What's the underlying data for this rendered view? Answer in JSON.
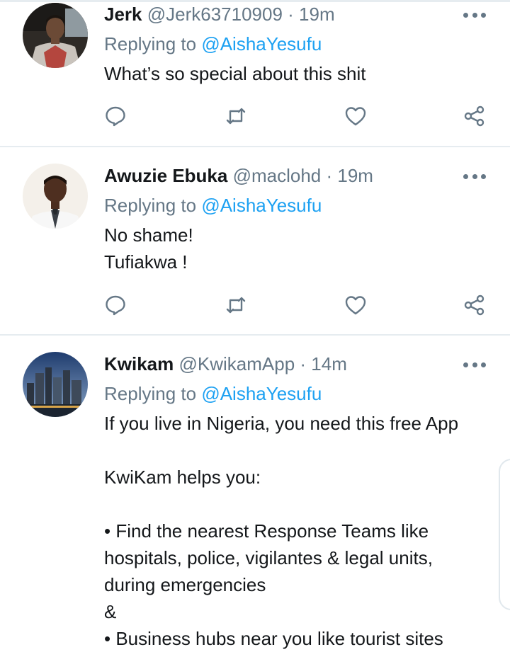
{
  "tweets": [
    {
      "name": "Jerk",
      "handle": "@Jerk63710909",
      "time": "· 19m",
      "replying_prefix": "Replying to",
      "replying_to": "@AishaYesufu",
      "lines": [
        "What’s so special about this shit"
      ]
    },
    {
      "name": "Awuzie Ebuka",
      "handle": "@maclohd",
      "time": "· 19m",
      "replying_prefix": "Replying to",
      "replying_to": "@AishaYesufu",
      "lines": [
        "No shame!",
        "Tufiakwa !"
      ]
    },
    {
      "name": "Kwikam",
      "handle": "@KwikamApp",
      "time": "· 14m",
      "replying_prefix": "Replying to",
      "replying_to": "@AishaYesufu",
      "lines": [
        "If you live in Nigeria, you need this free App",
        "",
        "KwiKam helps you:",
        "",
        "• Find the nearest Response Teams like",
        "hospitals, police, vigilantes & legal units,",
        "during emergencies",
        "&",
        "• Business hubs near you like tourist sites"
      ]
    }
  ],
  "icons": {
    "reply": "reply-icon",
    "retweet": "retweet-icon",
    "like": "heart-icon",
    "share": "share-icon",
    "more": "more-options-icon"
  },
  "colors": {
    "link": "#1da1f2",
    "muted": "#657786",
    "text": "#14171a",
    "divider": "#e6ecf0"
  }
}
